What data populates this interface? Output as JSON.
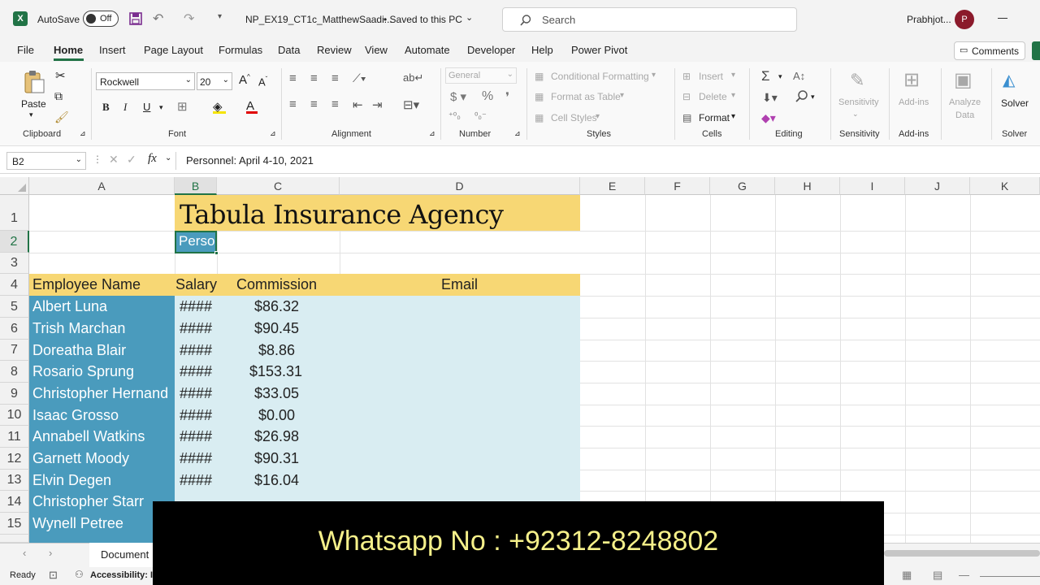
{
  "titlebar": {
    "autosave_label": "AutoSave",
    "autosave_state": "Off",
    "filename": "NP_EX19_CT1c_MatthewSaadi...",
    "save_status": "• Saved to this PC",
    "search_placeholder": "Search",
    "user_name": "Prabhjot...",
    "avatar_letter": "P"
  },
  "menu": [
    "File",
    "Home",
    "Insert",
    "Page Layout",
    "Formulas",
    "Data",
    "Review",
    "View",
    "Automate",
    "Developer",
    "Help",
    "Power Pivot"
  ],
  "comments_label": "Comments",
  "ribbon": {
    "paste": "Paste",
    "font_name": "Rockwell",
    "font_size": "20",
    "number_format": "General",
    "cond_format": "Conditional Formatting",
    "format_table": "Format as Table",
    "cell_styles": "Cell Styles",
    "insert": "Insert",
    "delete": "Delete",
    "format": "Format",
    "sensitivity": "Sensitivity",
    "addins": "Add-ins",
    "analyze_1": "Analyze",
    "analyze_2": "Data",
    "solver": "Solver",
    "groups": [
      "Clipboard",
      "Font",
      "Alignment",
      "Number",
      "Styles",
      "Cells",
      "Editing",
      "Sensitivity",
      "Add-ins",
      "Solver"
    ]
  },
  "formula_bar": {
    "name_box": "B2",
    "formula": "Personnel: April 4-10, 2021"
  },
  "columns": [
    "A",
    "B",
    "C",
    "D",
    "E",
    "F",
    "G",
    "H",
    "I",
    "J",
    "K"
  ],
  "rows": [
    "1",
    "2",
    "3",
    "4",
    "5",
    "6",
    "7",
    "8",
    "9",
    "10",
    "11",
    "12",
    "13",
    "14",
    "15"
  ],
  "sheet": {
    "title": "Tabula Insurance Agency",
    "b2_text": "Perso",
    "headers": [
      "Employee Name",
      "Salary",
      "Commission",
      "Email"
    ],
    "employees": [
      {
        "name": "Albert Luna",
        "salary": "####",
        "commission": "$86.32"
      },
      {
        "name": "Trish Marchan",
        "salary": "####",
        "commission": "$90.45"
      },
      {
        "name": "Doreatha Blair",
        "salary": "####",
        "commission": "$8.86"
      },
      {
        "name": "Rosario Sprung",
        "salary": "####",
        "commission": "$153.31"
      },
      {
        "name": "Christopher Hernand",
        "salary": "####",
        "commission": "$33.05"
      },
      {
        "name": "Isaac Grosso",
        "salary": "####",
        "commission": "$0.00"
      },
      {
        "name": "Annabell Watkins",
        "salary": "####",
        "commission": "$26.98"
      },
      {
        "name": "Garnett Moody",
        "salary": "####",
        "commission": "$90.31"
      },
      {
        "name": "Elvin Degen",
        "salary": "####",
        "commission": "$16.04"
      },
      {
        "name": "Christopher Starr",
        "salary": "",
        "commission": ""
      },
      {
        "name": "Wynell Petree",
        "salary": "",
        "commission": ""
      }
    ]
  },
  "sheet_tab": "Document",
  "status": {
    "ready": "Ready",
    "accessibility": "Accessibility: In"
  },
  "overlay_text": "Whatsapp No : +92312-8248802",
  "colors": {
    "title_fill": "#f7d774",
    "name_fill": "#4a9bbd",
    "data_fill": "#d9edf2",
    "excel_green": "#217346"
  }
}
